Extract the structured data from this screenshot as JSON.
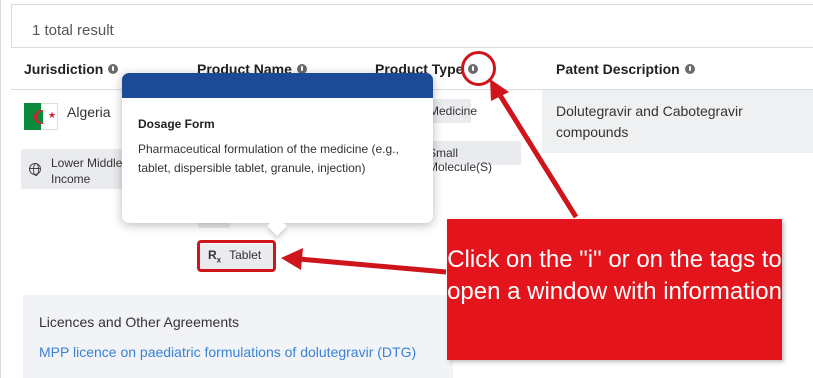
{
  "results": {
    "count_text": "1 total result"
  },
  "table": {
    "headers": {
      "jurisdiction": "Jurisdiction",
      "product_name": "Product Name",
      "product_type": "Product Type",
      "patent_description": "Patent Description"
    },
    "row": {
      "country": "Algeria",
      "income_tag": "Lower Middle Income",
      "product_type_tags": [
        "Medicine",
        "Small Molecule(S)"
      ],
      "dosage_tag": "Tablet",
      "patent_description": "Dolutegravir and Cabotegravir compounds"
    }
  },
  "popover": {
    "title": "Dosage Form",
    "body": "Pharmaceutical formulation of the medicine (e.g., tablet, dispersible tablet, granule, injection)"
  },
  "licences": {
    "title": "Licences and Other Agreements",
    "link_text": "MPP licence on paediatric formulations of dolutegravir (DTG)"
  },
  "annotation": {
    "text": "Click on the \"i\" or on the tags to open a window with information"
  },
  "colors": {
    "highlight_red": "#d0141b",
    "popover_header": "#1d4a94",
    "link_blue": "#3b82d6"
  },
  "icons": [
    "info-icon",
    "globe-icon",
    "rx-icon",
    "algeria-flag"
  ]
}
